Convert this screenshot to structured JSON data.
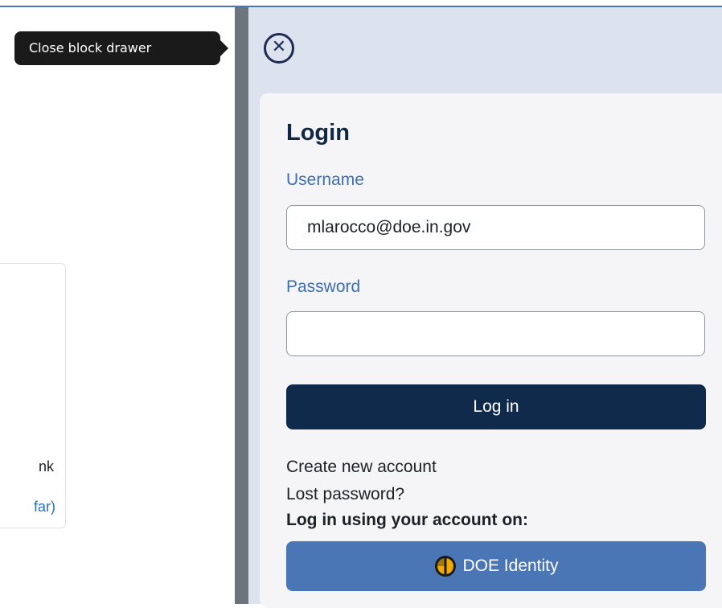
{
  "background_page": {
    "fragment_ink": "nk",
    "fragment_far": "far)"
  },
  "tooltip": {
    "text": "Close block drawer"
  },
  "drawer": {
    "close_icon": "close-circle-icon",
    "login": {
      "title": "Login",
      "username_label": "Username",
      "username_value": "mlarocco@doe.in.gov",
      "password_label": "Password",
      "password_value": "",
      "login_button": "Log in",
      "create_account": "Create new account",
      "lost_password": "Lost password?",
      "alt_login_heading": "Log in using your account on:",
      "identity_provider": {
        "label": "DOE Identity",
        "icon": "doe-identity-logo-icon"
      }
    }
  },
  "colors": {
    "accent": "#4a76b5",
    "primary_button": "#102a4c",
    "drawer_bg": "#dde3ee",
    "label_blue": "#3c6fb1"
  }
}
